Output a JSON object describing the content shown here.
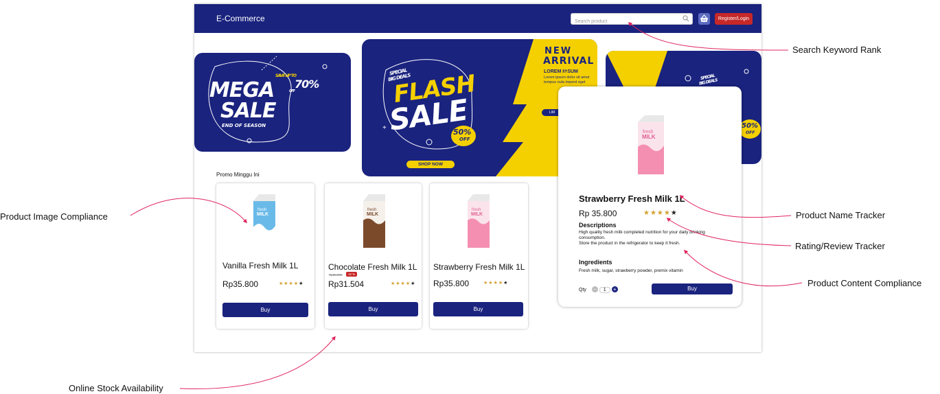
{
  "header": {
    "brand": "E-Commerce",
    "search_placeholder": "Search product",
    "login_label": "Register/Login"
  },
  "banners": {
    "mega": {
      "save_up_to": "SAVE UP TO",
      "percent": "70%",
      "off": "OFF",
      "line1": "MEGA",
      "line2": "SALE",
      "sub": "END OF SEASON"
    },
    "flash": {
      "special": "SPECIAL",
      "big_deals": "BIG DEALS",
      "line1": "FLASH",
      "line2": "SALE",
      "percent": "50%",
      "off": "OFF",
      "cta": "SHOP NOW",
      "new": "NEW",
      "arrival": "ARRIVAL",
      "lorem_title": "LOREM I℗SUM",
      "lorem_text": "Lorem ipsum dolor sit amet tempus nula imperd eget",
      "lim": "LIM"
    },
    "third": {
      "special": "SPECIAL",
      "big_deals": "BIG DEALS",
      "percent": "50%",
      "off": "OFF"
    }
  },
  "promo": {
    "title": "Promo Minggu Ini",
    "products": [
      {
        "name": "Vanilla Fresh Milk 1L",
        "price": "Rp35.800",
        "old_price": "",
        "discount": "",
        "rating": 4,
        "buy_label": "Buy",
        "carton_color": "#5ab4e5",
        "carton_label": "fresh MILK"
      },
      {
        "name": "Chocolate Fresh Milk 1L",
        "price": "Rp31.504",
        "old_price": "Rp35.800",
        "discount": "12 %",
        "rating": 4,
        "buy_label": "Buy",
        "carton_color": "#7b4a2b",
        "carton_label": "fresh MILK"
      },
      {
        "name": "Strawberry Fresh Milk 1L",
        "price": "Rp35.800",
        "old_price": "",
        "discount": "",
        "rating": 4,
        "buy_label": "Buy",
        "carton_color": "#f48fb1",
        "carton_label": "fresh MILK"
      }
    ]
  },
  "detail": {
    "name": "Strawberry Fresh Milk 1L",
    "price": "Rp 35.800",
    "rating": 4,
    "desc_heading": "Descriptions",
    "desc_line1": "High quality fresh milk completed nutrition for your daily drinking consumption.",
    "desc_line2": "Store the product in the refrigerator to keep it fresh.",
    "ing_heading": "Ingredients",
    "ingredients": "Fresh milk, sugar, strawberry powder, premix vitamin",
    "qty_label": "Qty",
    "qty_value": "1",
    "buy_label": "Buy"
  },
  "callouts": {
    "search": "Search Keyword Rank",
    "image": "Product Image Compliance",
    "name": "Product Name Tracker",
    "rating": "Rating/Review Tracker",
    "content": "Product Content Compliance",
    "stock": "Online Stock Availability"
  },
  "colors": {
    "navy": "#1a237e",
    "red": "#c62828",
    "yellow": "#f5d000",
    "callout_line": "#e0245e"
  }
}
